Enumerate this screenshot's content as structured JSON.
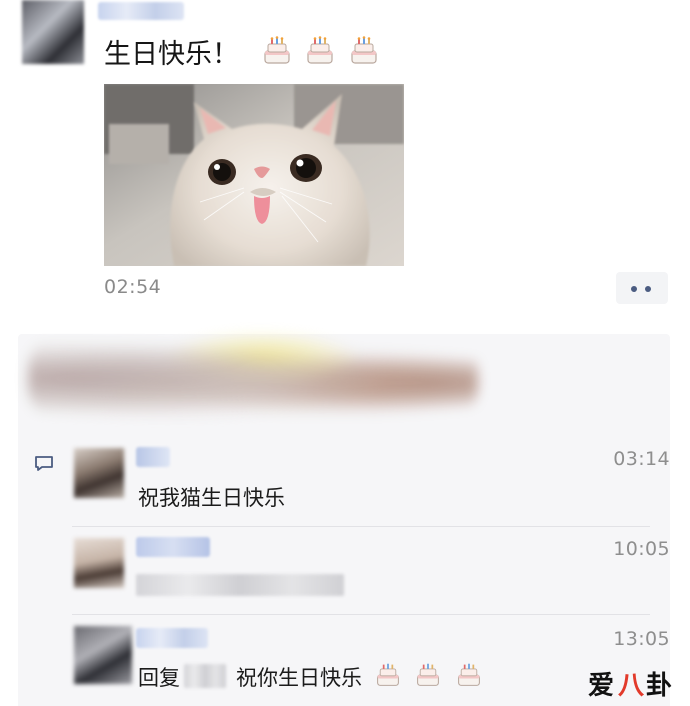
{
  "post": {
    "text": "生日快乐！",
    "cake_icons": [
      "birthday-cake-icon",
      "birthday-cake-icon",
      "birthday-cake-icon"
    ],
    "time": "02:54",
    "image": "white-persian-cat-photo"
  },
  "actions": {
    "icon": "more-dots-icon"
  },
  "comments": [
    {
      "time": "03:14",
      "text": "祝我猫生日快乐"
    },
    {
      "time": "10:05",
      "text": ""
    },
    {
      "time": "13:05",
      "reply_prefix": "回复",
      "text": "祝你生日快乐",
      "cake_icons": [
        "birthday-cake-icon",
        "birthday-cake-icon",
        "birthday-cake-icon"
      ]
    }
  ],
  "watermark": {
    "text": "爱八卦",
    "color_main": "#111111",
    "color_accent": "#e23a2b"
  },
  "colors": {
    "timestamp": "#8e8e8e",
    "comment_bg": "#f6f6f8",
    "link_blue": "#4b5c81"
  }
}
